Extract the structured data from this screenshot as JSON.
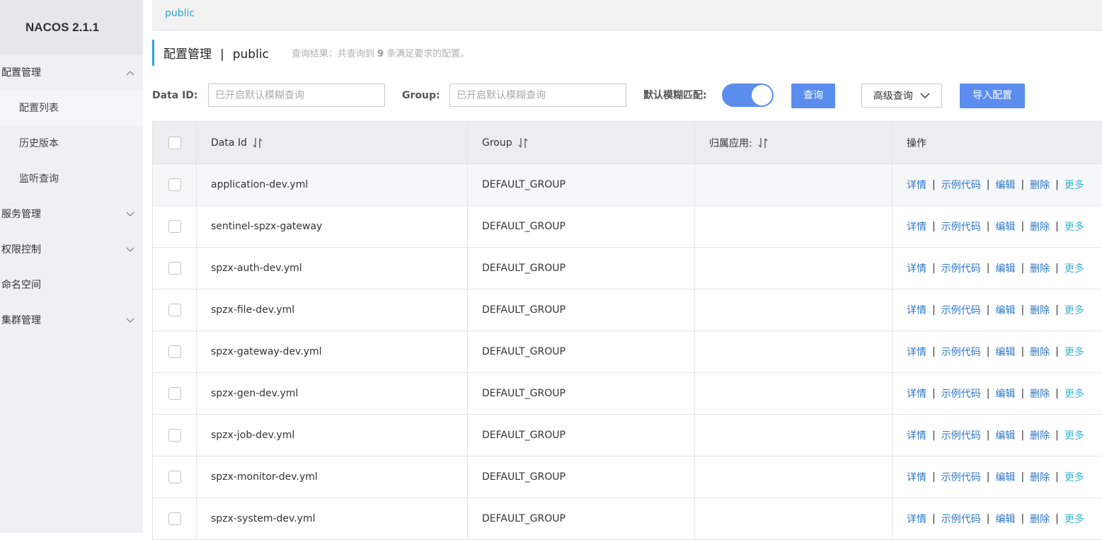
{
  "app": {
    "title": "NACOS 2.1.1"
  },
  "sidebar": {
    "items": [
      {
        "label": "配置管理",
        "expanded": true
      },
      {
        "label": "配置列表",
        "sub": true,
        "active": true
      },
      {
        "label": "历史版本",
        "sub": true
      },
      {
        "label": "监听查询",
        "sub": true
      },
      {
        "label": "服务管理",
        "expanded": false
      },
      {
        "label": "权限控制",
        "expanded": false
      },
      {
        "label": "命名空间"
      },
      {
        "label": "集群管理",
        "expanded": false
      }
    ]
  },
  "namespace_tab": "public",
  "page": {
    "title": "配置管理",
    "namespace": "public",
    "separator": "|",
    "hint_prefix": "查询结果：共查询到",
    "hint_count": "9",
    "hint_suffix": "条满足要求的配置。"
  },
  "search": {
    "data_id_label": "Data ID:",
    "data_id_placeholder": "已开启默认模糊查询",
    "group_label": "Group:",
    "group_placeholder": "已开启默认模糊查询",
    "fuzzy_label": "默认模糊匹配:",
    "fuzzy_enabled": true,
    "query_button": "查询",
    "advanced_button": "高级查询",
    "import_button": "导入配置"
  },
  "table": {
    "columns": [
      "Data Id",
      "Group",
      "归属应用:",
      "操作"
    ],
    "actions": [
      "详情",
      "示例代码",
      "编辑",
      "删除",
      "更多"
    ],
    "rows": [
      {
        "data_id": "application-dev.yml",
        "group": "DEFAULT_GROUP",
        "app": ""
      },
      {
        "data_id": "sentinel-spzx-gateway",
        "group": "DEFAULT_GROUP",
        "app": ""
      },
      {
        "data_id": "spzx-auth-dev.yml",
        "group": "DEFAULT_GROUP",
        "app": ""
      },
      {
        "data_id": "spzx-file-dev.yml",
        "group": "DEFAULT_GROUP",
        "app": ""
      },
      {
        "data_id": "spzx-gateway-dev.yml",
        "group": "DEFAULT_GROUP",
        "app": ""
      },
      {
        "data_id": "spzx-gen-dev.yml",
        "group": "DEFAULT_GROUP",
        "app": ""
      },
      {
        "data_id": "spzx-job-dev.yml",
        "group": "DEFAULT_GROUP",
        "app": ""
      },
      {
        "data_id": "spzx-monitor-dev.yml",
        "group": "DEFAULT_GROUP",
        "app": ""
      },
      {
        "data_id": "spzx-system-dev.yml",
        "group": "DEFAULT_GROUP",
        "app": ""
      }
    ]
  },
  "colors": {
    "primary": "#5b8def",
    "accent": "#2fa3d6",
    "link": "#2c76c8",
    "more_link": "#3bb3d0",
    "sidebar_bg": "#eef0f3"
  }
}
